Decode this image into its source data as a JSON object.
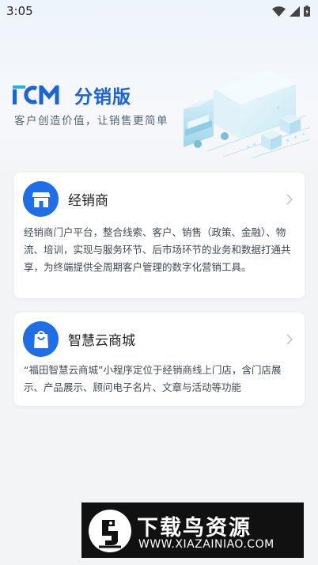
{
  "status_bar": {
    "time": "3:05"
  },
  "header": {
    "logo_text": "ICM",
    "app_name": "分销版",
    "slogan": "客户创造价值，让销售更简单"
  },
  "cards": [
    {
      "title": "经销商",
      "description": "经销商门户平台，整合线索、客户、销售（政策、金融）、物流、培训，实现与服务环节、后市场环节的业务和数据打通共享，为终端提供全周期客户管理的数字化营销工具。",
      "icon": "store-icon"
    },
    {
      "title": "智慧云商城",
      "description": "“福田智慧云商城”小程序定位于经销商线上门店，含门店展示、产品展示、顾问电子名片、文章与活动等功能",
      "icon": "shopping-bag-icon"
    }
  ],
  "watermark": {
    "title": "下载鸟资源",
    "url": "WWW.XIAZAINIAO.COM"
  },
  "colors": {
    "brand_blue": "#1a63d8",
    "icon_blue": "#1f6ee8",
    "background": "#f3f4f6",
    "card": "#ffffff"
  }
}
